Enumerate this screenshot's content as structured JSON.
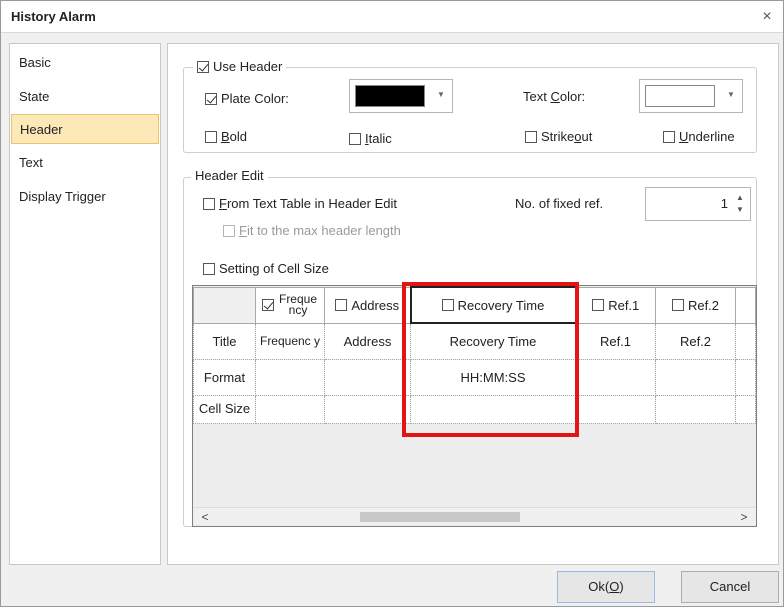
{
  "window": {
    "title": "History Alarm",
    "close_glyph": "×"
  },
  "sidebar": {
    "items": [
      {
        "label": "Basic",
        "active": false
      },
      {
        "label": "State",
        "active": false
      },
      {
        "label": "Header",
        "active": true
      },
      {
        "label": "Text",
        "active": false
      },
      {
        "label": "Display Trigger",
        "active": false
      }
    ]
  },
  "header_group": {
    "use_header": {
      "label": "Use Header",
      "checked": true
    },
    "plate_color": {
      "label": "Plate Color:",
      "checked": true,
      "color": "#000000"
    },
    "text_color": {
      "label_pre": "Text ",
      "label_u": "C",
      "label_post": "olor:",
      "color": "#ffffff"
    },
    "bold": {
      "label_u": "B",
      "label_post": "old",
      "checked": false
    },
    "italic": {
      "label_u": "I",
      "label_post": "talic",
      "checked": false
    },
    "strikeout": {
      "label_pre": "Strike",
      "label_u": "o",
      "label_post": "ut",
      "checked": false
    },
    "underline": {
      "label_u": "U",
      "label_post": "nderline",
      "checked": false
    }
  },
  "header_edit": {
    "title": "Header Edit",
    "from_text_table": {
      "label_u": "F",
      "label_post": "rom Text Table in Header Edit",
      "checked": false
    },
    "fit_max": {
      "label_u": "F",
      "label_post": "it to the max header length",
      "checked": false,
      "disabled": true
    },
    "fixed_ref": {
      "label": "No. of fixed ref.",
      "value": "1"
    },
    "cell_size": {
      "label": "Setting of Cell Size",
      "checked": false
    }
  },
  "grid": {
    "columns": [
      {
        "header": "Freque ncy",
        "checked": true
      },
      {
        "header": "Address",
        "checked": false
      },
      {
        "header": "Recovery Time",
        "checked": false
      },
      {
        "header": "Ref.1",
        "checked": false
      },
      {
        "header": "Ref.2",
        "checked": false
      }
    ],
    "rows": [
      {
        "label": "Title",
        "cells": [
          "Frequenc y",
          "Address",
          "Recovery Time",
          "Ref.1",
          "Ref.2"
        ]
      },
      {
        "label": "Format",
        "cells": [
          "",
          "",
          "HH:MM:SS",
          "",
          ""
        ]
      },
      {
        "label": "Cell Size",
        "cells": [
          "",
          "",
          "",
          "",
          ""
        ]
      }
    ],
    "scroll_left": "<",
    "scroll_right": ">"
  },
  "buttons": {
    "ok_pre": "Ok(",
    "ok_u": "O",
    "ok_post": ")",
    "cancel": "Cancel"
  },
  "colors": {
    "highlight": "#e31414",
    "active_tab": "#fde8b7"
  }
}
